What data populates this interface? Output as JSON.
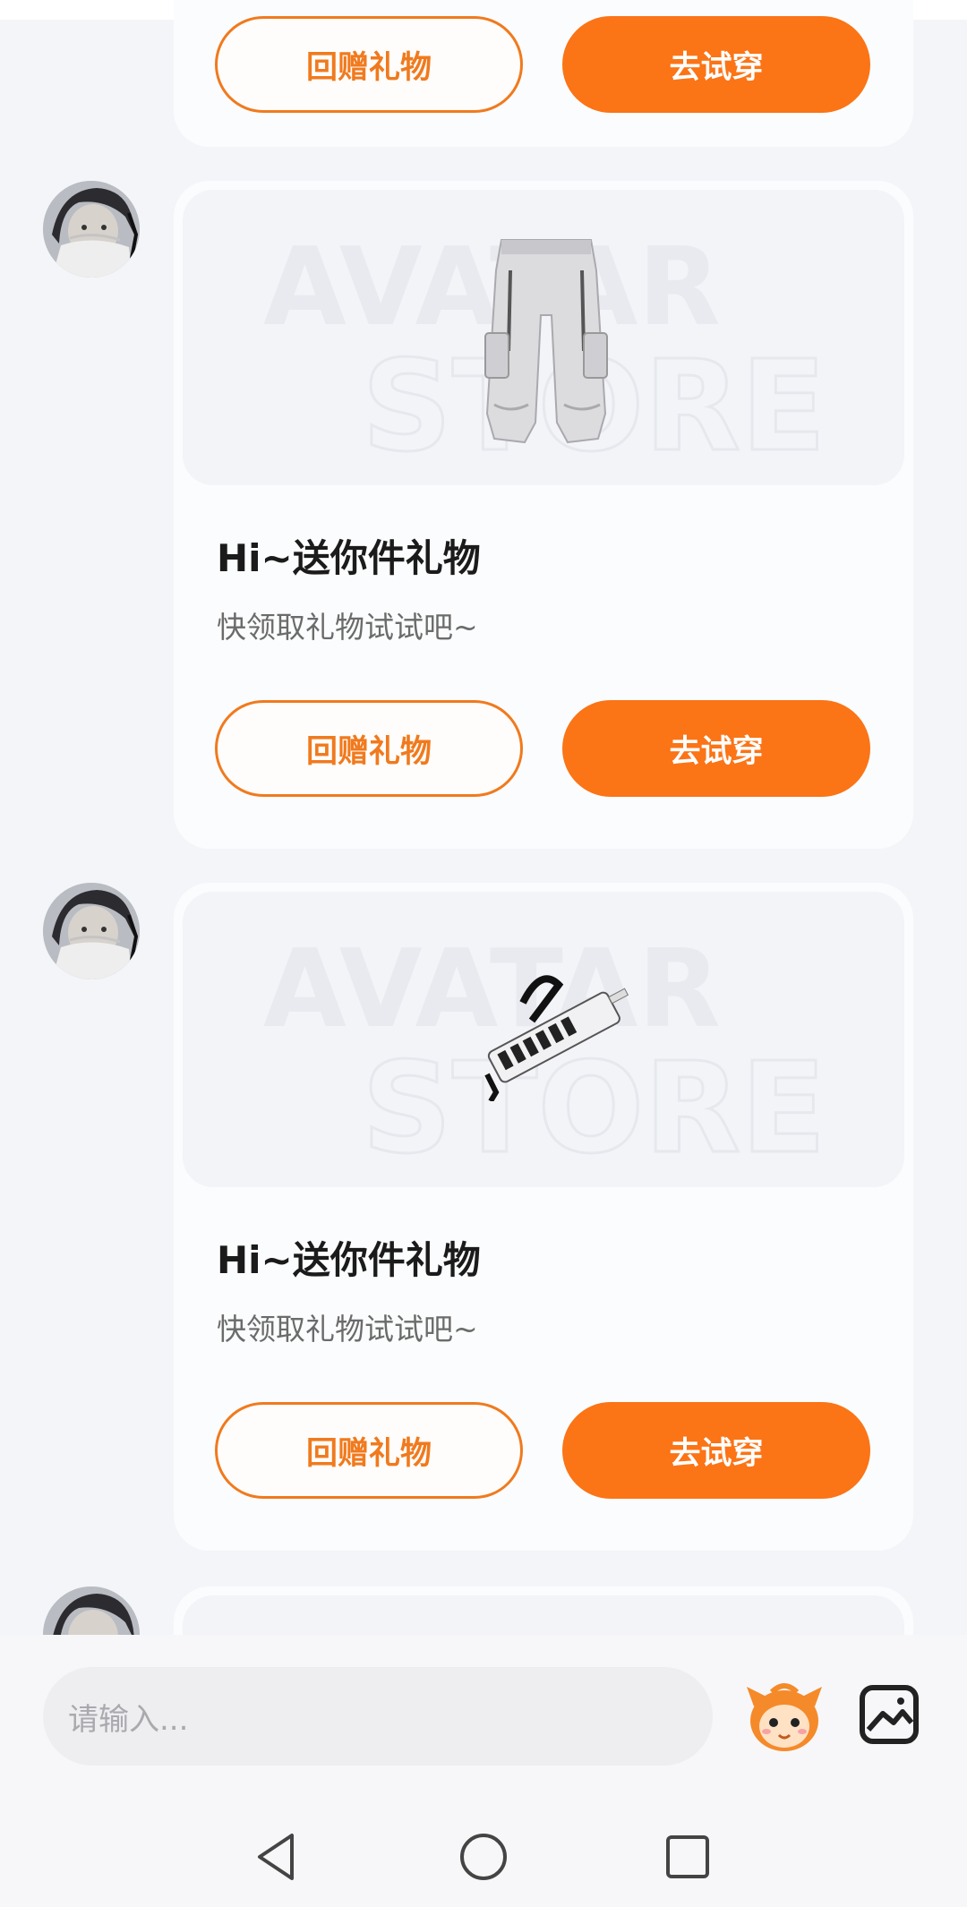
{
  "gifts": [
    {
      "reply_label": "回赠礼物",
      "try_label": "去试穿"
    },
    {
      "item": "pants-icon",
      "title": "Hi~送你件礼物",
      "subtitle": "快领取礼物试试吧~",
      "reply_label": "回赠礼物",
      "try_label": "去试穿"
    },
    {
      "item": "keytar-icon",
      "title": "Hi~送你件礼物",
      "subtitle": "快领取礼物试试吧~",
      "reply_label": "回赠礼物",
      "try_label": "去试穿"
    }
  ],
  "input": {
    "placeholder": "请输入..."
  },
  "icons": {
    "emoji": "emoji-mascot-icon",
    "image": "image-icon",
    "nav": [
      "nav-back-icon",
      "nav-home-icon",
      "nav-recents-icon"
    ]
  },
  "colors": {
    "accent": "#fb7416",
    "outline": "#f07a1e"
  }
}
